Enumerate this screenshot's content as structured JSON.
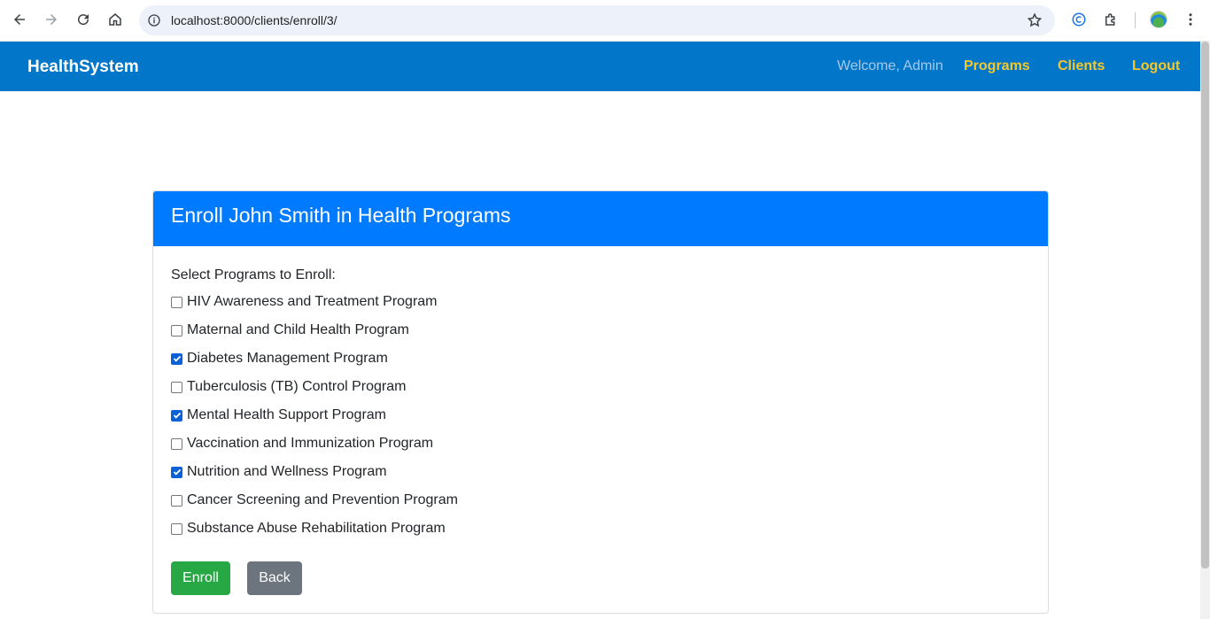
{
  "browser": {
    "url": "localhost:8000/clients/enroll/3/"
  },
  "navbar": {
    "brand": "HealthSystem",
    "welcome": "Welcome, Admin",
    "links": [
      "Programs",
      "Clients",
      "Logout"
    ]
  },
  "card": {
    "title": "Enroll John Smith in Health Programs",
    "select_label": "Select Programs to Enroll:",
    "programs": [
      {
        "label": "HIV Awareness and Treatment Program",
        "checked": false
      },
      {
        "label": "Maternal and Child Health Program",
        "checked": false
      },
      {
        "label": "Diabetes Management Program",
        "checked": true
      },
      {
        "label": "Tuberculosis (TB) Control Program",
        "checked": false
      },
      {
        "label": "Mental Health Support Program",
        "checked": true
      },
      {
        "label": "Vaccination and Immunization Program",
        "checked": false
      },
      {
        "label": "Nutrition and Wellness Program",
        "checked": true
      },
      {
        "label": "Cancer Screening and Prevention Program",
        "checked": false
      },
      {
        "label": "Substance Abuse Rehabilitation Program",
        "checked": false
      }
    ],
    "enroll_label": "Enroll",
    "back_label": "Back"
  },
  "colors": {
    "navbar": "#0277c9",
    "header": "#007bff",
    "link": "#f5c82a",
    "enroll": "#28a745",
    "back": "#6c757d"
  }
}
